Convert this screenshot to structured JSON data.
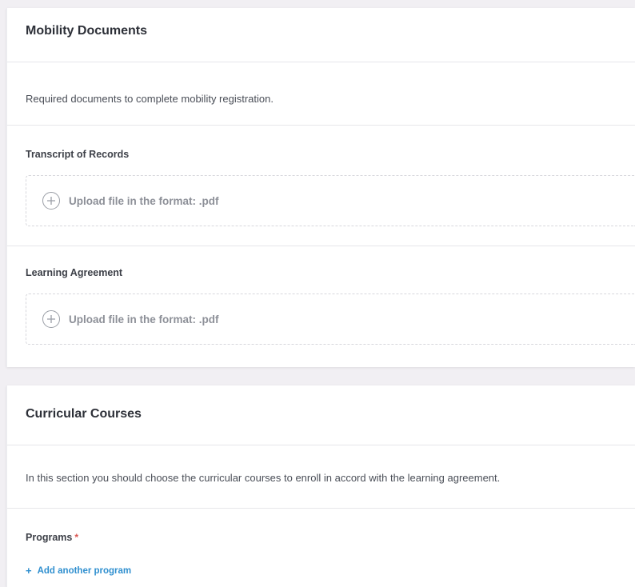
{
  "mobility": {
    "title": "Mobility Documents",
    "description": "Required documents to complete mobility registration.",
    "transcript": {
      "label": "Transcript of Records",
      "upload_text": "Upload file in the format: .pdf"
    },
    "learning_agreement": {
      "label": "Learning Agreement",
      "upload_text": "Upload file in the format: .pdf"
    }
  },
  "courses": {
    "title": "Curricular Courses",
    "description": "In this section you should choose the curricular courses to enroll in accord with the learning agreement.",
    "programs_label": "Programs",
    "required_marker": "*",
    "add_program_icon": "+",
    "add_program_label": "Add another program"
  },
  "colors": {
    "page_bg": "#f1eff3",
    "card_bg": "#ffffff",
    "link": "#2f8fcf",
    "required": "#d9534f"
  },
  "icons": [
    "plus-circle-icon",
    "plus-icon"
  ]
}
